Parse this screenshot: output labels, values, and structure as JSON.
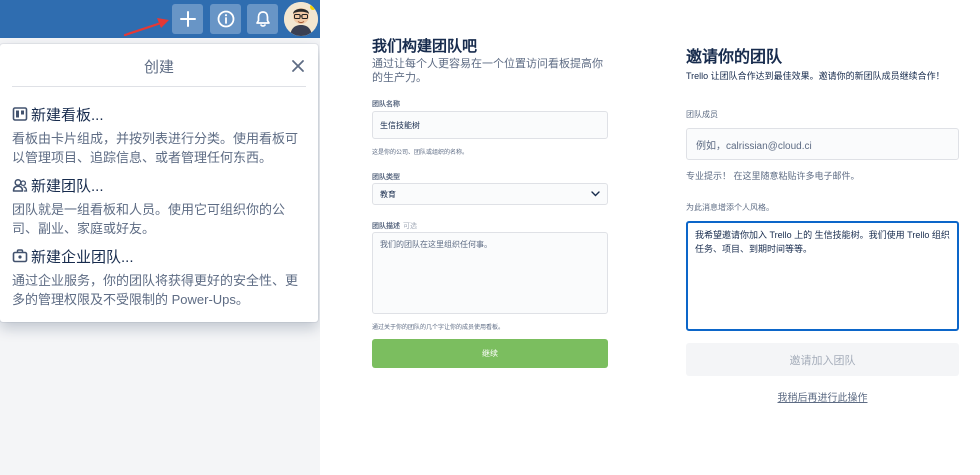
{
  "create_popover": {
    "title": "创建",
    "options": [
      {
        "title": "新建看板...",
        "description": "看板由卡片组成，并按列表进行分类。使用看板可以管理项目、追踪信息、或者管理任何东西。"
      },
      {
        "title": "新建团队...",
        "description": "团队就是一组看板和人员。使用它可组织你的公司、副业、家庭或好友。"
      },
      {
        "title": "新建企业团队...",
        "description": "通过企业服务，你的团队将获得更好的安全性、更多的管理权限及不受限制的 Power-Ups。"
      }
    ]
  },
  "team_form": {
    "heading": "我们构建团队吧",
    "subheading": "通过让每个人更容易在一个位置访问看板提高你的生产力。",
    "name_label": "团队名称",
    "name_value": "生信技能树",
    "name_hint": "这是你的公司、团队或组织的名称。",
    "type_label": "团队类型",
    "type_value": "教育",
    "desc_label": "团队描述",
    "desc_optional": "可选",
    "desc_value": "我们的团队在这里组织任何事。",
    "desc_hint": "通过关于你的团队的几个字让你的成员使用看板。",
    "continue_label": "继续"
  },
  "invite": {
    "title": "邀请你的团队",
    "subtitle": "Trello 让团队合作达到最佳效果。邀请你的新团队成员继续合作！",
    "members_label": "团队成员",
    "members_placeholder": "例如，calrissian@cloud.ci",
    "tip": "专业提示！ 在这里随意粘贴许多电子邮件。",
    "message_label": "为此消息增添个人风格。",
    "message_value": "我希望邀请你加入 Trello 上的 生信技能树。我们使用 Trello 组织任务、项目、到期时间等等。",
    "invite_button": "邀请加入团队",
    "later_link": "我稍后再进行此操作"
  },
  "colors": {
    "header_blue": "#2f6db0",
    "continue_green": "#7bbe5f",
    "focus_blue": "#0c66c9",
    "annotation_red": "#e53935"
  }
}
